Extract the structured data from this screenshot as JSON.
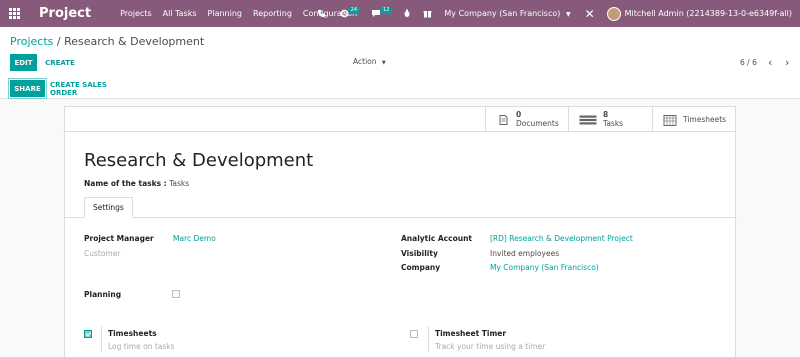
{
  "app": {
    "brand": "Project"
  },
  "menu": [
    "Projects",
    "All Tasks",
    "Planning",
    "Reporting",
    "Configuration"
  ],
  "systray": {
    "activity_count": "24",
    "messages_count": "12",
    "company": "My Company (San Francisco)",
    "user": "Mitchell Admin (2214389-13-0-e6349f-all)"
  },
  "breadcrumb": {
    "parent": "Projects",
    "separator": "/",
    "current": "Research & Development"
  },
  "buttons": {
    "edit": "EDIT",
    "create": "CREATE",
    "action": "Action",
    "share": "SHARE",
    "create_sales_order": "CREATE SALES ORDER"
  },
  "pager": {
    "value": "6 / 6"
  },
  "stat_buttons": {
    "documents": {
      "value": "0",
      "label": "Documents"
    },
    "tasks": {
      "value": "8",
      "label": "Tasks"
    },
    "timesheets": {
      "label": "Timesheets"
    }
  },
  "record": {
    "title": "Research & Development",
    "tasks_name_label": "Name of the tasks :",
    "tasks_name_value": "Tasks"
  },
  "tabs": {
    "settings": "Settings"
  },
  "fields": {
    "project_manager_label": "Project Manager",
    "project_manager_value": "Marc Demo",
    "customer_label": "Customer",
    "analytic_account_label": "Analytic Account",
    "analytic_account_value": "[RD] Research & Development Project",
    "visibility_label": "Visibility",
    "visibility_value": "Invited employees",
    "company_label": "Company",
    "company_value": "My Company (San Francisco)",
    "planning_label": "Planning",
    "timesheets_label": "Timesheets",
    "timesheets_help": "Log time on tasks",
    "timesheet_timer_label": "Timesheet Timer",
    "timesheet_timer_help": "Track your time using a timer"
  },
  "colors": {
    "navbar": "#875a7b",
    "accent": "#00a09d"
  }
}
